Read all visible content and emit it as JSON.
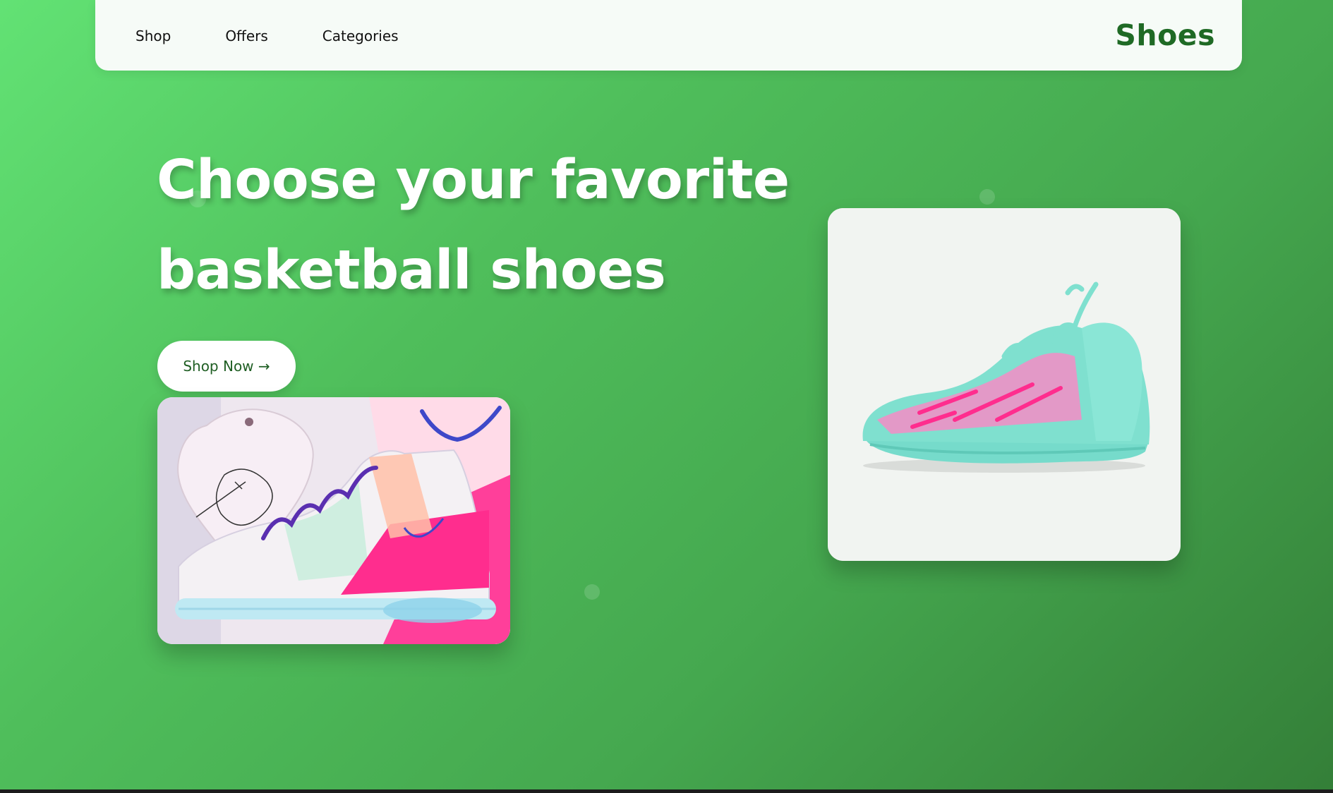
{
  "nav": {
    "links": [
      "Shop",
      "Offers",
      "Categories"
    ],
    "brand": "Shoes"
  },
  "hero": {
    "title_line1": "Choose your favorite",
    "title_line2": "basketball shoes",
    "cta_label": "Shop Now →"
  },
  "colors": {
    "background_start": "#62e274",
    "background_end": "#347f38",
    "brand": "#1f6a25",
    "navbar_bg": "#f6fbf7"
  }
}
